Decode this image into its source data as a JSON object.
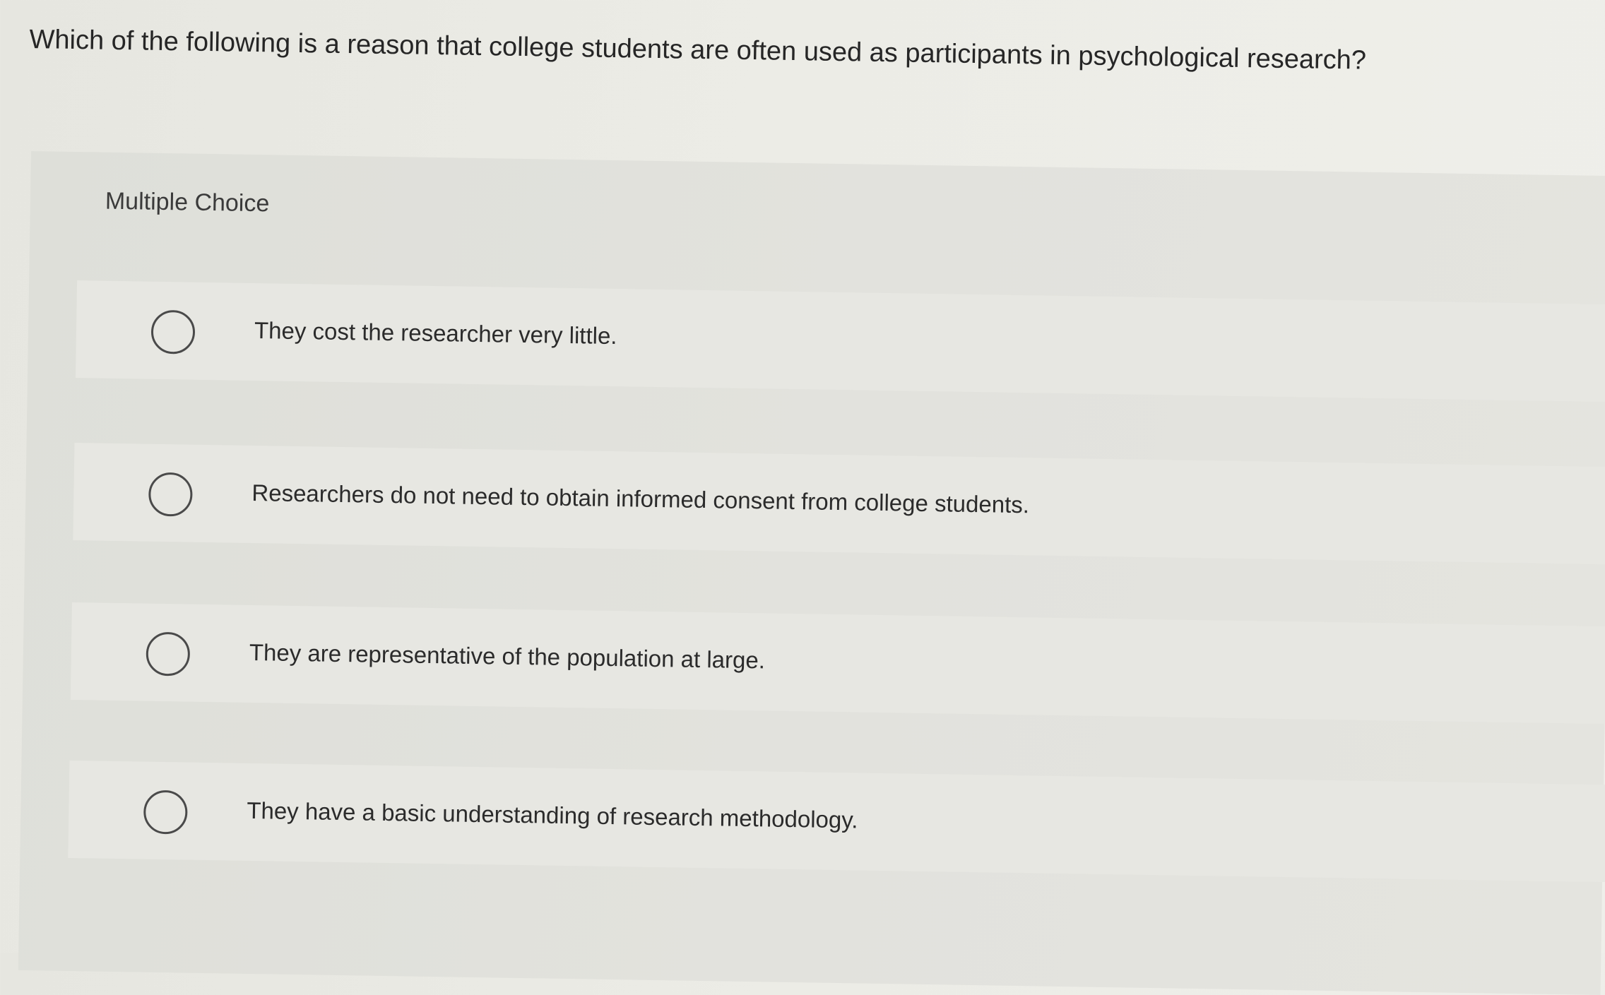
{
  "question": {
    "text": "Which of the following is a reason that college students are often used as participants in psychological research?"
  },
  "panel": {
    "label": "Multiple Choice"
  },
  "choices": [
    {
      "label": "They cost the researcher very little."
    },
    {
      "label": "Researchers do not need to obtain informed consent from college students."
    },
    {
      "label": "They are representative of the population at large."
    },
    {
      "label": "They have a basic understanding of research methodology."
    }
  ]
}
